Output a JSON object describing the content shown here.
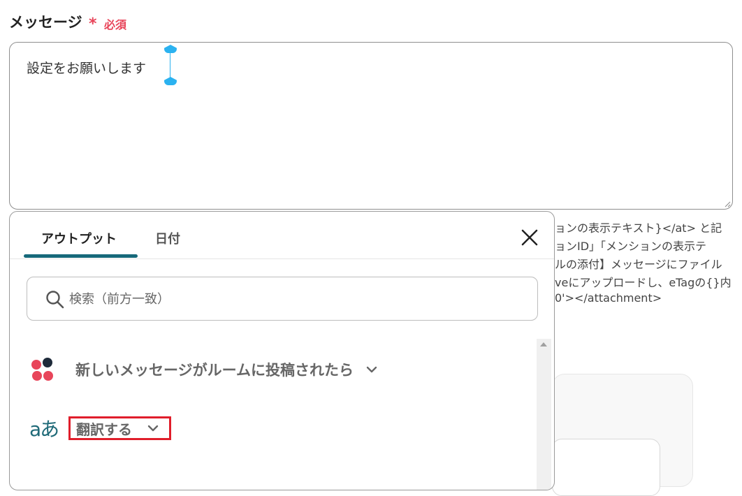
{
  "field": {
    "label": "メッセージ",
    "required_mark": "*",
    "required_text": "必須"
  },
  "message": {
    "value": "設定をお願いします"
  },
  "help_text": [
    "ョンの表示テキスト}</at> と記",
    "ョンID」「メンションの表示テ",
    "ルの添付】メッセージにファイル",
    "veにアップロードし、eTagの{}内",
    "0'></attachment>"
  ],
  "popup": {
    "tabs": [
      {
        "label": "アウトプット",
        "active": true
      },
      {
        "label": "日付",
        "active": false
      }
    ],
    "search": {
      "placeholder": "検索（前方一致）",
      "value": ""
    },
    "operations": [
      {
        "label": "新しいメッセージがルームに投稿されたら",
        "icon": "chatwork-logo-icon"
      },
      {
        "label": "翻訳する",
        "icon": "translate-icon",
        "icon_text": "aあ",
        "highlighted": true
      }
    ]
  },
  "colors": {
    "accent": "#16697a",
    "required": "#e8455a",
    "highlight_border": "#e01e2b",
    "cursor": "#2bb2f0"
  }
}
